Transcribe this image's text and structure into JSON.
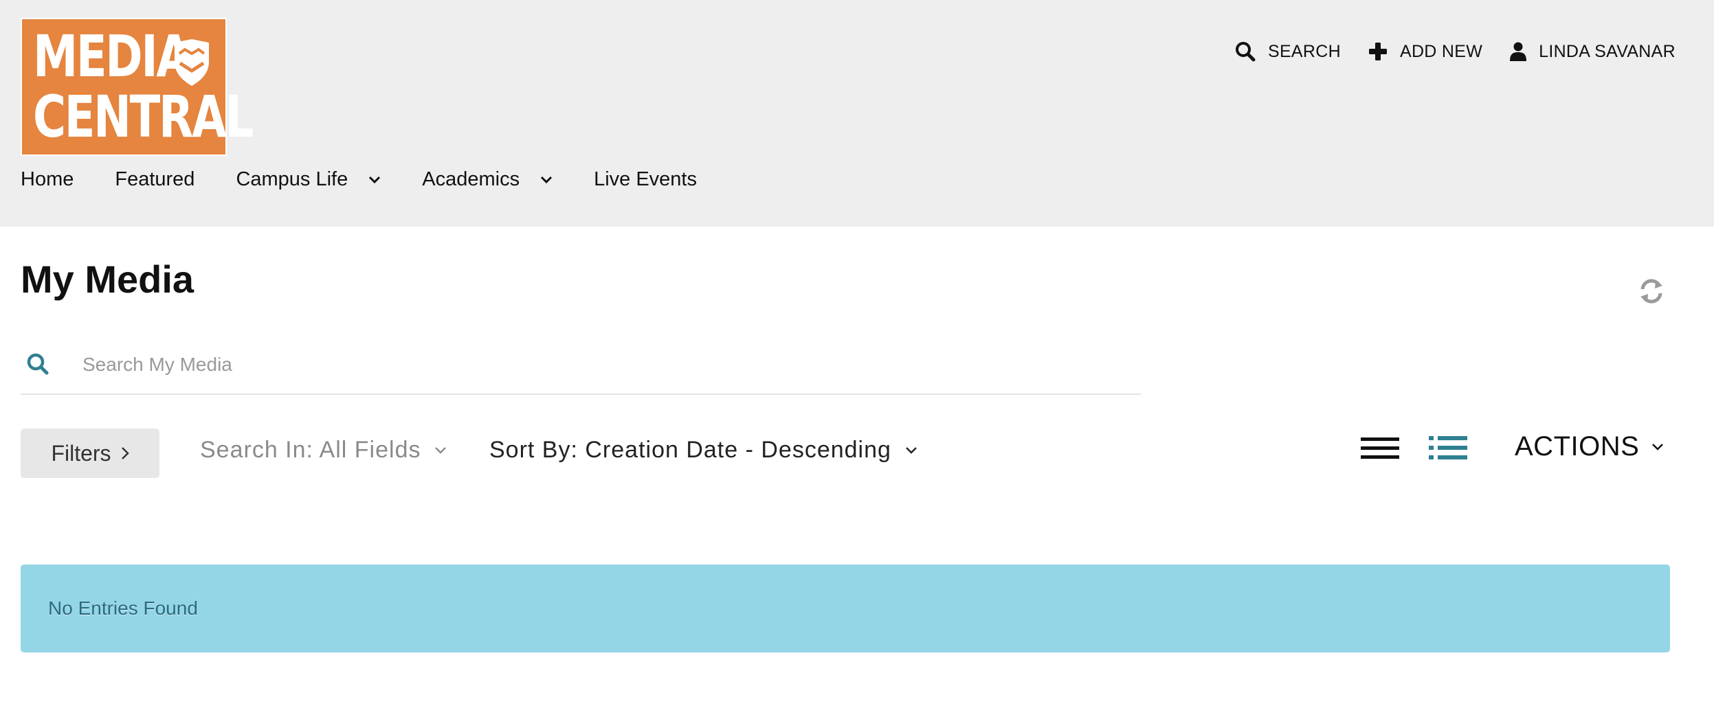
{
  "logo": {
    "line1": "MEDIA",
    "line2": "CENTRAL"
  },
  "top_actions": {
    "search": {
      "label": "SEARCH",
      "icon": "search-icon"
    },
    "add_new": {
      "label": "ADD NEW",
      "icon": "plus-icon"
    },
    "user": {
      "label": "LINDA SAVANAR",
      "icon": "user-icon"
    }
  },
  "nav": {
    "items": [
      {
        "label": "Home",
        "has_dropdown": false
      },
      {
        "label": "Featured",
        "has_dropdown": false
      },
      {
        "label": "Campus Life",
        "has_dropdown": true
      },
      {
        "label": "Academics",
        "has_dropdown": true
      },
      {
        "label": "Live Events",
        "has_dropdown": false
      }
    ]
  },
  "page": {
    "title": "My Media"
  },
  "search": {
    "placeholder": "Search My Media",
    "value": ""
  },
  "toolbar": {
    "filters_label": "Filters",
    "search_in_label": "Search In: All Fields",
    "sort_label": "Sort By: Creation Date - Descending",
    "actions_label": "ACTIONS"
  },
  "message": {
    "text": "No Entries Found"
  },
  "colors": {
    "header_bg": "#eeeeee",
    "logo_bg": "#e5853f",
    "accent_teal": "#2f7f92",
    "alert_bg": "#94d6e6",
    "alert_text": "#2c6a80"
  }
}
